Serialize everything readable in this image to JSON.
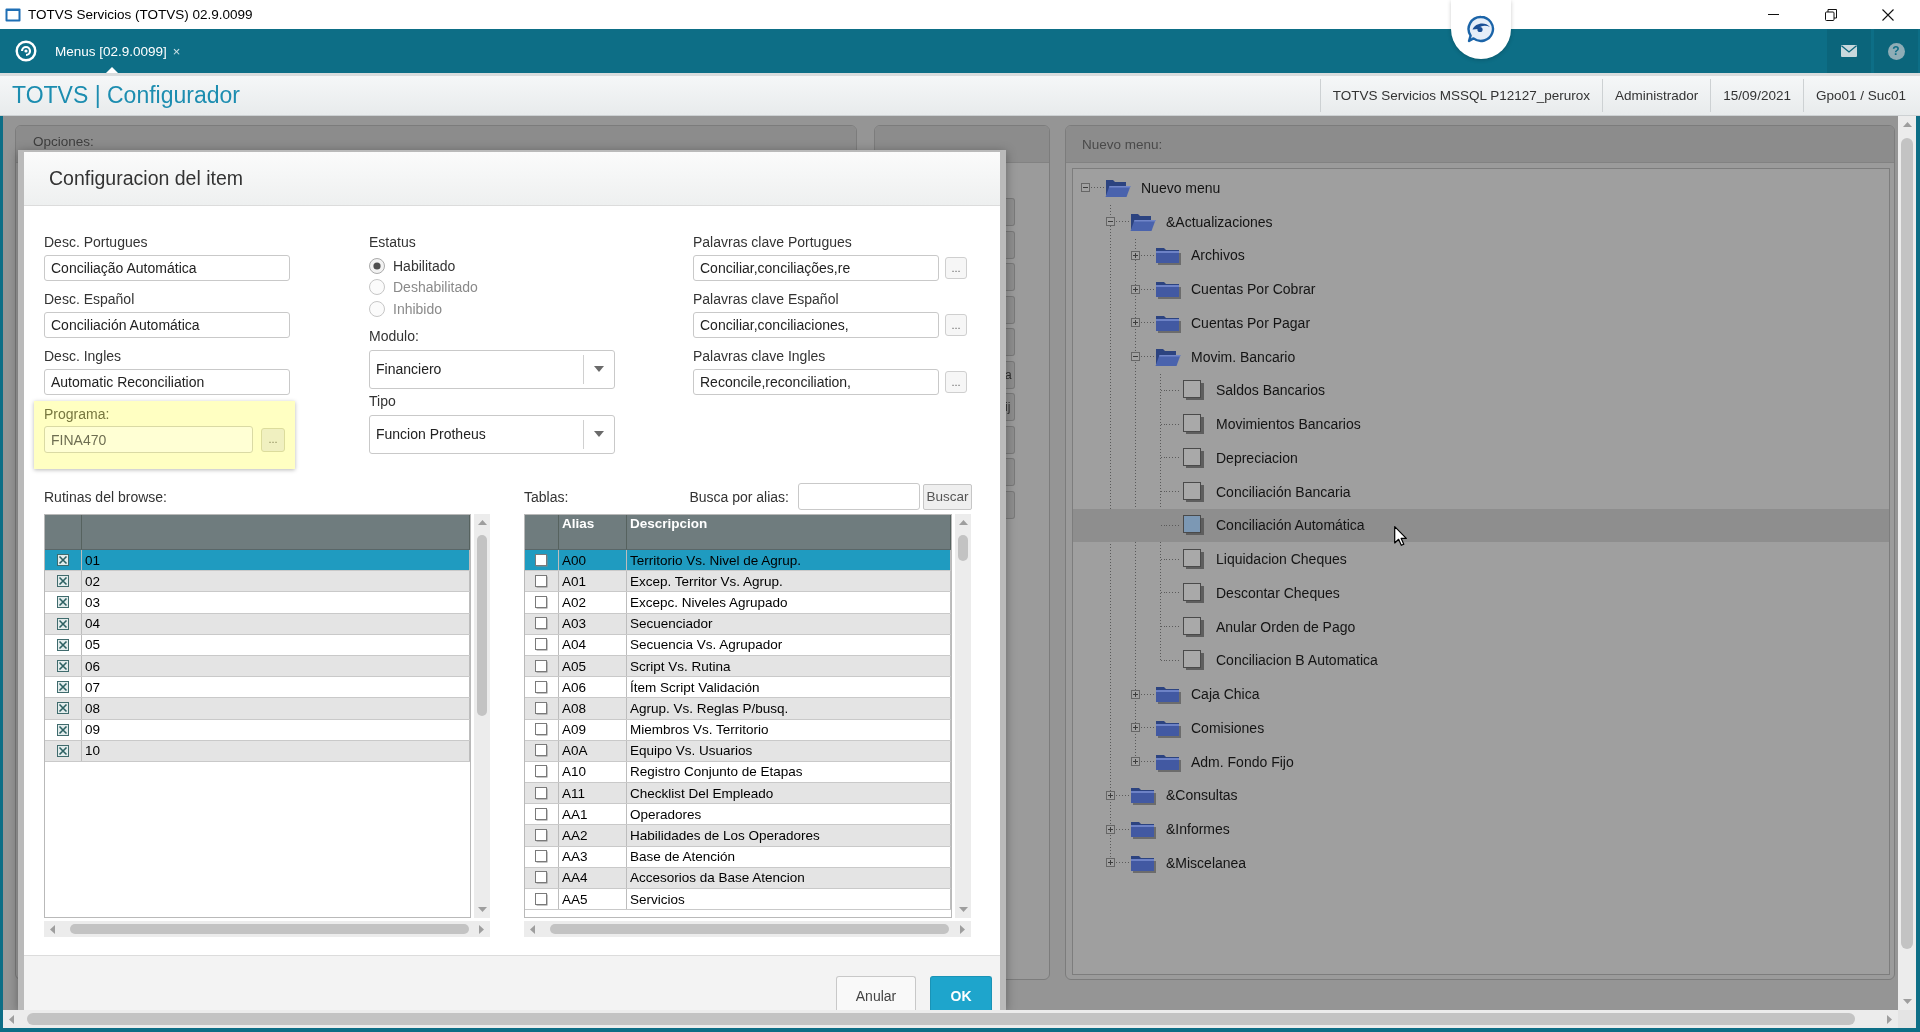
{
  "window": {
    "title": "TOTVS Servicios (TOTVS) 02.9.0099"
  },
  "toolbar": {
    "tabs": [
      {
        "label": "Menus [02.9.0099]",
        "close": "×",
        "selected": true
      }
    ],
    "help": "?"
  },
  "header": {
    "app_title": "TOTVS | Configurador",
    "info": [
      "TOTVS Servicios MSSQL P12127_perurox",
      "Administrador",
      "15/09/2021",
      "Gpo01 / Suc01"
    ]
  },
  "options_panel": {
    "title": "Opciones:"
  },
  "middle_panel": {
    "buttons": [
      {
        "kind": "plain"
      },
      {
        "kind": "plain"
      },
      {
        "kind": "plain"
      },
      {
        "kind": "plain"
      },
      {
        "kind": "plain"
      },
      {
        "kind": "text",
        "label": "a"
      },
      {
        "kind": "text",
        "label": "ij"
      },
      {
        "kind": "plain"
      },
      {
        "kind": "plain"
      },
      {
        "kind": "plain"
      }
    ]
  },
  "dialog": {
    "title": "Configuracion del item",
    "descriptions": [
      {
        "label": "Desc. Portugues",
        "value": "Conciliação Automática"
      },
      {
        "label": "Desc. Español",
        "value": "Conciliación Automática"
      },
      {
        "label": "Desc. Ingles",
        "value": "Automatic Reconciliation"
      }
    ],
    "program": {
      "label": "Programa:",
      "value": "FINA470",
      "button": "..."
    },
    "status": {
      "label": "Estatus",
      "options": [
        {
          "label": "Habilitado",
          "selected": true
        },
        {
          "label": "Deshabilitado",
          "selected": false
        },
        {
          "label": "Inhibido",
          "selected": false
        }
      ]
    },
    "selects": [
      {
        "label": "Modulo:",
        "value": "Financiero"
      },
      {
        "label": "Tipo",
        "value": "Funcion Protheus"
      }
    ],
    "keywords": [
      {
        "label": "Palavras clave Portugues",
        "value": "Conciliar,conciliações,re",
        "button": "..."
      },
      {
        "label": "Palavras clave Español",
        "value": "Conciliar,conciliaciones,",
        "button": "..."
      },
      {
        "label": "Palavras clave Ingles",
        "value": "Reconcile,reconciliation,",
        "button": "..."
      }
    ],
    "routines": {
      "label": "Rutinas del browse:",
      "rows": [
        {
          "value": "01",
          "checked": true,
          "selected": true
        },
        {
          "value": "02",
          "checked": true,
          "selected": false
        },
        {
          "value": "03",
          "checked": true,
          "selected": false
        },
        {
          "value": "04",
          "checked": true,
          "selected": false
        },
        {
          "value": "05",
          "checked": true,
          "selected": false
        },
        {
          "value": "06",
          "checked": true,
          "selected": false
        },
        {
          "value": "07",
          "checked": true,
          "selected": false
        },
        {
          "value": "08",
          "checked": true,
          "selected": false
        },
        {
          "value": "09",
          "checked": true,
          "selected": false
        },
        {
          "value": "10",
          "checked": true,
          "selected": false
        }
      ]
    },
    "tables": {
      "label": "Tablas:",
      "search_label": "Busca por alias:",
      "search_button": "Buscar",
      "columns": [
        "Alias",
        "Descripcion"
      ],
      "rows": [
        {
          "alias": "A00",
          "description": "Territorio Vs. Nivel de Agrup.",
          "checked": false,
          "selected": true
        },
        {
          "alias": "A01",
          "description": "Excep. Territor Vs. Agrup.",
          "checked": false,
          "selected": false
        },
        {
          "alias": "A02",
          "description": "Excepc. Niveles Agrupado",
          "checked": false,
          "selected": false
        },
        {
          "alias": "A03",
          "description": "Secuenciador",
          "checked": false,
          "selected": false
        },
        {
          "alias": "A04",
          "description": "Secuencia Vs. Agrupador",
          "checked": false,
          "selected": false
        },
        {
          "alias": "A05",
          "description": "Script Vs. Rutina",
          "checked": false,
          "selected": false
        },
        {
          "alias": "A06",
          "description": "Ítem Script Validación",
          "checked": false,
          "selected": false
        },
        {
          "alias": "A08",
          "description": "Agrup. Vs. Reglas P/busq.",
          "checked": false,
          "selected": false
        },
        {
          "alias": "A09",
          "description": "Miembros Vs. Territorio",
          "checked": false,
          "selected": false
        },
        {
          "alias": "A0A",
          "description": "Equipo Vs. Usuarios",
          "checked": false,
          "selected": false
        },
        {
          "alias": "A10",
          "description": "Registro Conjunto de Etapas",
          "checked": false,
          "selected": false
        },
        {
          "alias": "A11",
          "description": "Checklist Del Empleado",
          "checked": false,
          "selected": false
        },
        {
          "alias": "AA1",
          "description": "Operadores",
          "checked": false,
          "selected": false
        },
        {
          "alias": "AA2",
          "description": "Habilidades de Los Operadores",
          "checked": false,
          "selected": false
        },
        {
          "alias": "AA3",
          "description": "Base de Atención",
          "checked": false,
          "selected": false
        },
        {
          "alias": "AA4",
          "description": "Accesorios da Base Atencion",
          "checked": false,
          "selected": false
        },
        {
          "alias": "AA5",
          "description": "Servicios",
          "checked": false,
          "selected": false
        }
      ]
    },
    "buttons": [
      {
        "label": "Anular",
        "kind": "secondary"
      },
      {
        "label": "OK",
        "kind": "primary"
      }
    ]
  },
  "menu_panel": {
    "title": "Nuevo menu:",
    "tree": [
      {
        "label": "Nuevo menu",
        "kind": "folder",
        "expanded": true,
        "selected": false,
        "children": [
          {
            "label": "&Actualizaciones",
            "kind": "folder",
            "expanded": true,
            "selected": false,
            "children": [
              {
                "label": "Archivos",
                "kind": "folder",
                "expanded": false,
                "selected": false
              },
              {
                "label": "Cuentas Por Cobrar",
                "kind": "folder",
                "expanded": false,
                "selected": false
              },
              {
                "label": "Cuentas Por Pagar",
                "kind": "folder",
                "expanded": false,
                "selected": false
              },
              {
                "label": "Movim. Bancario",
                "kind": "folder",
                "expanded": true,
                "selected": false,
                "children": [
                  {
                    "label": "Saldos Bancarios",
                    "kind": "item",
                    "selected": false
                  },
                  {
                    "label": "Movimientos Bancarios",
                    "kind": "item",
                    "selected": false
                  },
                  {
                    "label": "Depreciacion",
                    "kind": "item",
                    "selected": false
                  },
                  {
                    "label": "Conciliación Bancaria",
                    "kind": "item",
                    "selected": false
                  },
                  {
                    "label": "Conciliación Automática",
                    "kind": "item",
                    "selected": true
                  },
                  {
                    "label": "Liquidacion Cheques",
                    "kind": "item",
                    "selected": false
                  },
                  {
                    "label": "Descontar Cheques",
                    "kind": "item",
                    "selected": false
                  },
                  {
                    "label": "Anular Orden de Pago",
                    "kind": "item",
                    "selected": false
                  },
                  {
                    "label": "Conciliacion B Automatica",
                    "kind": "item",
                    "selected": false
                  }
                ]
              },
              {
                "label": "Caja Chica",
                "kind": "folder",
                "expanded": false,
                "selected": false
              },
              {
                "label": "Comisiones",
                "kind": "folder",
                "expanded": false,
                "selected": false
              },
              {
                "label": "Adm. Fondo Fijo",
                "kind": "folder",
                "expanded": false,
                "selected": false
              }
            ]
          },
          {
            "label": "&Consultas",
            "kind": "folder",
            "expanded": false,
            "selected": false
          },
          {
            "label": "&Informes",
            "kind": "folder",
            "expanded": false,
            "selected": false
          },
          {
            "label": "&Miscelanea",
            "kind": "folder",
            "expanded": false,
            "selected": false
          }
        ]
      }
    ]
  }
}
